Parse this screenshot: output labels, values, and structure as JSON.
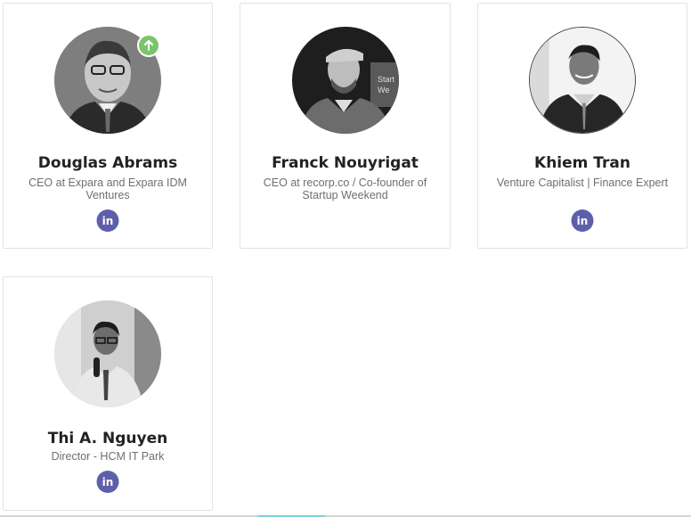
{
  "team": {
    "members": [
      {
        "name": "Douglas Abrams",
        "role": "CEO at Expara and Expara IDM Ventures",
        "photo_alt": "Douglas Abrams",
        "social_icon": "linkedin-icon",
        "social_label": "in"
      },
      {
        "name": "Franck Nouyrigat",
        "role": "CEO at recorp.co / Co-founder of Startup Weekend",
        "photo_alt": "Franck Nouyrigat",
        "social_icon": "linkedin-icon",
        "social_label": "in"
      },
      {
        "name": "Khiem Tran",
        "role": "Venture Capitalist | Finance Expert",
        "photo_alt": "Khiem Tran",
        "social_icon": "linkedin-icon",
        "social_label": "in"
      },
      {
        "name": "Thi A. Nguyen",
        "role": "Director - HCM IT Park",
        "photo_alt": "Thi A. Nguyen",
        "social_icon": "linkedin-icon",
        "social_label": "in"
      }
    ]
  },
  "scroll_top": {
    "icon": "arrow-up-icon"
  },
  "colors": {
    "linkedin": "#5e5faa",
    "badge": "#7cc46b",
    "accent": "#7ad2d7"
  }
}
